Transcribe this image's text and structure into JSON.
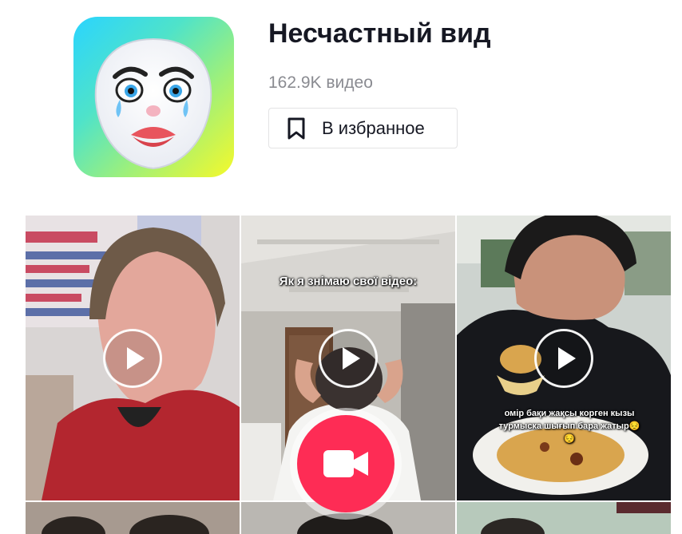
{
  "effect": {
    "title": "Несчастный вид",
    "video_count": "162.9K видео",
    "favorite_label": "В избранное",
    "icon_name": "sad-face-mask-icon"
  },
  "videos": [
    {
      "caption": "",
      "tile": "video-1"
    },
    {
      "caption": "Як я знімаю свої відео:",
      "tile": "video-2"
    },
    {
      "caption": "омір бақи жақсы корген кызы турмыска шығып бара жатыр😔😔",
      "tile": "video-3"
    }
  ],
  "colors": {
    "accent": "#fe2c55",
    "title": "#161823",
    "muted": "#8a8b91"
  },
  "icons": {
    "bookmark": "bookmark-icon",
    "play": "play-icon",
    "record": "video-camera-icon"
  }
}
